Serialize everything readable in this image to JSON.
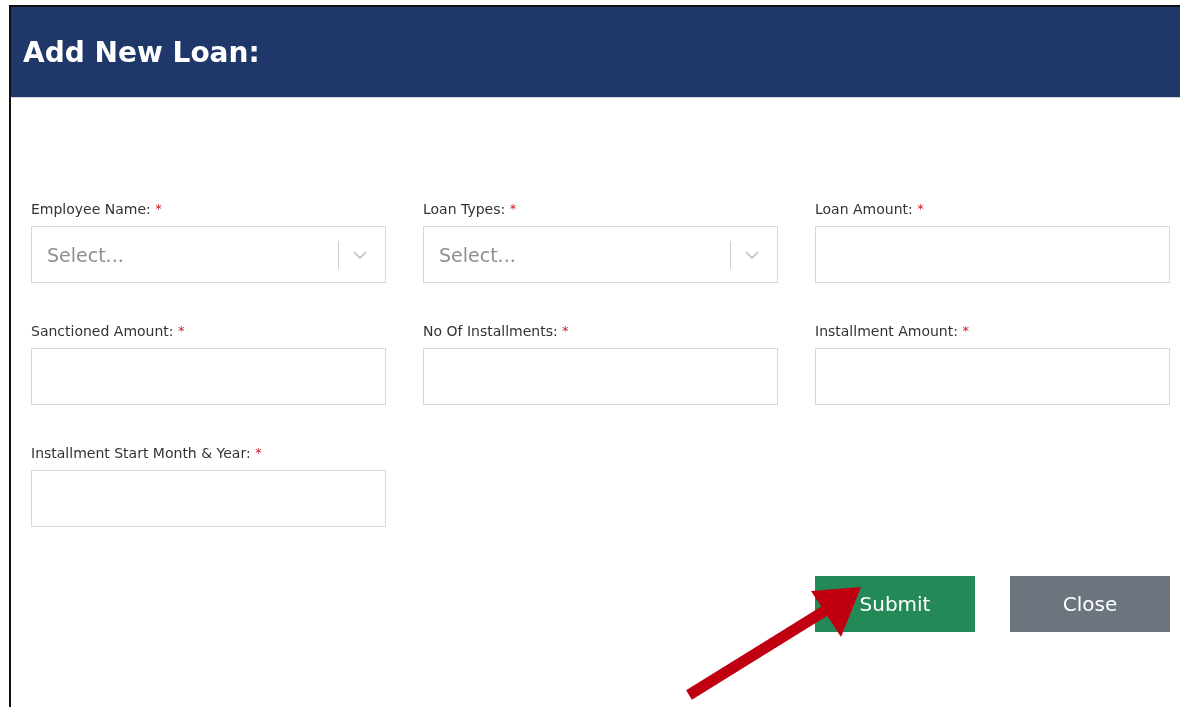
{
  "dialog": {
    "title": "Add New Loan:"
  },
  "fields": [
    {
      "kind": "select",
      "label": "Employee Name:",
      "required_mark": "*",
      "placeholder": "Select..."
    },
    {
      "kind": "select",
      "label": "Loan Types:",
      "required_mark": "*",
      "placeholder": "Select..."
    },
    {
      "kind": "text",
      "label": "Loan Amount:",
      "required_mark": "*"
    },
    {
      "kind": "text",
      "label": "Sanctioned Amount:",
      "required_mark": "*"
    },
    {
      "kind": "text",
      "label": "No Of Installments:",
      "required_mark": "*"
    },
    {
      "kind": "text",
      "label": "Installment Amount:",
      "required_mark": "*"
    },
    {
      "kind": "text",
      "label": "Installment Start Month & Year:",
      "required_mark": "*"
    }
  ],
  "buttons": [
    {
      "kind": "primary",
      "label": "Submit"
    },
    {
      "kind": "secondary",
      "label": "Close"
    }
  ]
}
